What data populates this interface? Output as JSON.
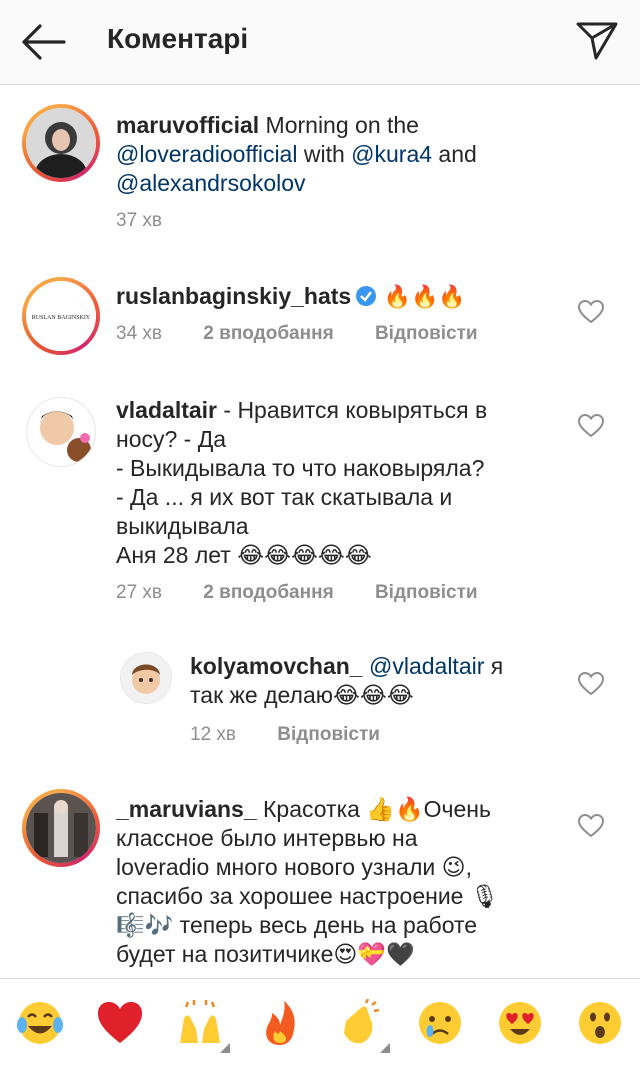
{
  "header": {
    "title": "Коментарі"
  },
  "caption": {
    "username": "maruvofficial",
    "text_parts": [
      "Morning on the",
      "@loveradioofficial",
      " with ",
      "@kura4",
      " and",
      "@alexandrsokolov"
    ],
    "time": "37 хв"
  },
  "comments": [
    {
      "username": "ruslanbaginskiy_hats",
      "avatar_text": "RUSLAN BAGINSKIY",
      "text": "🔥🔥🔥",
      "time": "34 хв",
      "likes": "2 вподобання",
      "reply": "Відповісти"
    },
    {
      "username": "vladaltair",
      "lines": [
        " - Нравится ковыряться в",
        "носу? - Да",
        "-  Выкидывала то что наковыряла?",
        "- Да ... я их вот так скатывала  и",
        "выкидывала",
        " Аня 28 лет 😂😂😂😂😂"
      ],
      "time": "27 хв",
      "likes": "2 вподобання",
      "reply": "Відповісти"
    },
    {
      "username": "kolyamovchan_",
      "mention": "@vladaltair",
      "line1_tail": " я",
      "line2": "так же делаю😂😂😂",
      "time": "12 хв",
      "reply": "Відповісти"
    },
    {
      "username": "_maruvians_",
      "lines": [
        " Красотка 👍🔥Очень",
        "классное было интервью  на",
        "loveradio много нового узнали 😉,",
        "спасибо за хорошее настроение 🎙",
        "🎼🎶 теперь весь день на работе",
        "будет на позитичике😍💝🖤"
      ]
    }
  ],
  "emoji_bar": [
    "😂",
    "❤",
    "🙌",
    "🔥",
    "👏",
    "😢",
    "😍",
    "😮"
  ],
  "colors": {
    "link": "#003569",
    "meta": "#8e8e8e",
    "verified": "#3897f0"
  }
}
